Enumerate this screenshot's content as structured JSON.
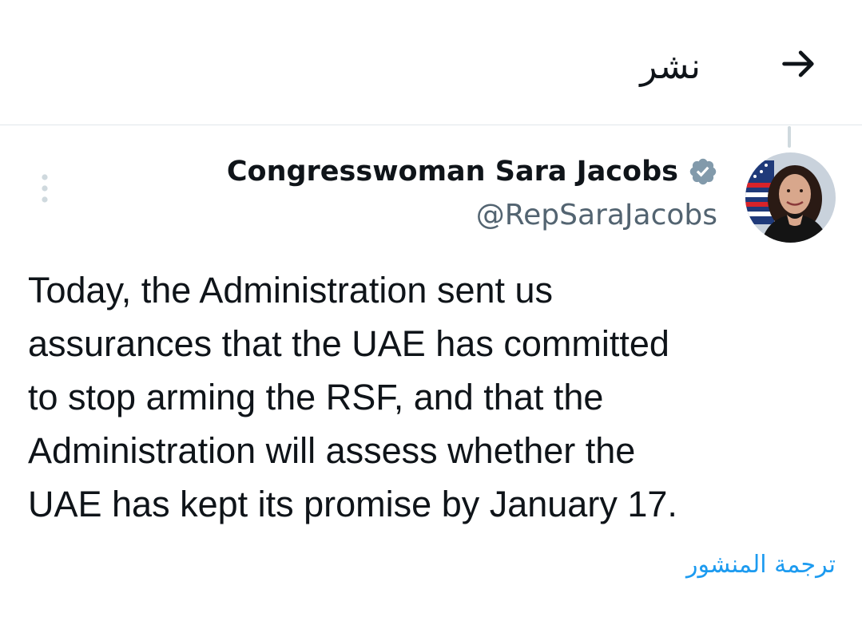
{
  "header": {
    "title": "نشر",
    "back_icon": "arrow-right-icon"
  },
  "tweet": {
    "author": {
      "display_name": "Congresswoman Sara Jacobs",
      "handle": "@RepSaraJacobs",
      "verified_icon": "verified-badge-icon",
      "verified_color": "#829aab"
    },
    "menu_icon": "more-vertical-icon",
    "text_lines": [
      "Today, the Administration sent us",
      "assurances that the UAE has committed",
      "to stop arming the RSF, and that the",
      "Administration will assess whether the",
      "UAE has kept its promise by January 17."
    ],
    "translate_label": "ترجمة المنشور"
  },
  "colors": {
    "text_primary": "#0f1419",
    "text_secondary": "#536471",
    "link": "#1d9bf0",
    "divider": "#e1e6ea"
  }
}
